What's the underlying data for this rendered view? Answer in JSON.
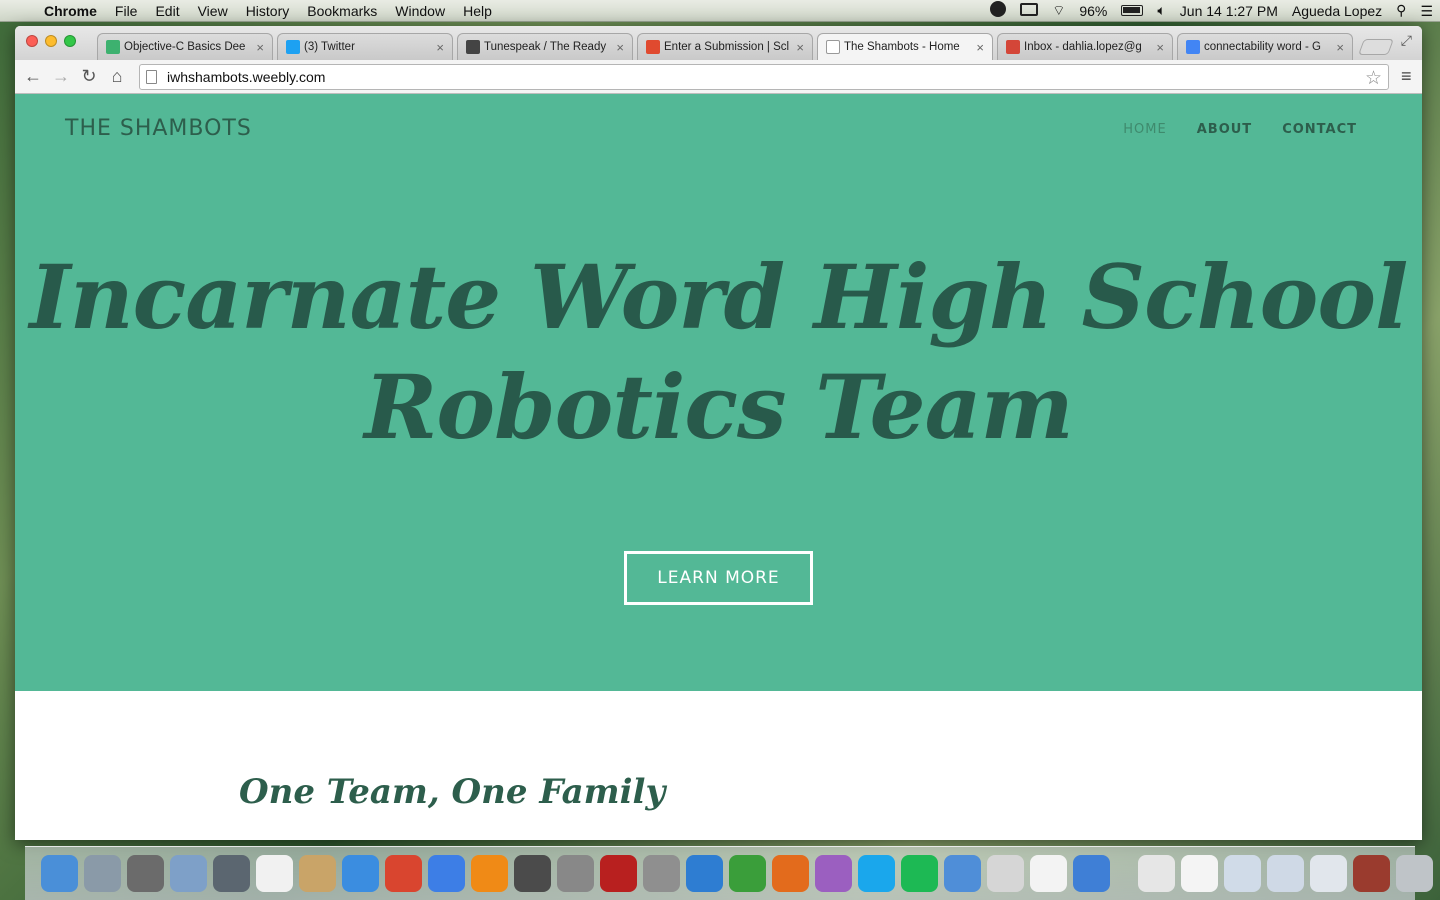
{
  "menubar": {
    "app_name": "Chrome",
    "items": [
      "File",
      "Edit",
      "View",
      "History",
      "Bookmarks",
      "Window",
      "Help"
    ],
    "battery": "96%",
    "datetime": "Jun 14  1:27 PM",
    "user": "Agueda Lopez"
  },
  "tabs": [
    {
      "title": "Objective-C Basics Dee",
      "favicon_color": "#3db16f",
      "active": false
    },
    {
      "title": "(3) Twitter",
      "favicon_color": "#1da1f2",
      "active": false
    },
    {
      "title": "Tunespeak / The Ready",
      "favicon_color": "#444444",
      "active": false
    },
    {
      "title": "Enter a Submission | Scl",
      "favicon_color": "#e04a2f",
      "active": false
    },
    {
      "title": "The Shambots - Home",
      "favicon_color": "#ffffff",
      "active": true
    },
    {
      "title": "Inbox - dahlia.lopez@g",
      "favicon_color": "#d44638",
      "active": false
    },
    {
      "title": "connectability word - G",
      "favicon_color": "#4285f4",
      "active": false
    }
  ],
  "address_bar": {
    "url": "iwhshambots.weebly.com"
  },
  "site": {
    "title": "THE SHAMBOTS",
    "nav": [
      {
        "label": "HOME",
        "active": true
      },
      {
        "label": "ABOUT",
        "active": false
      },
      {
        "label": "CONTACT",
        "active": false
      }
    ],
    "headline_line1": "Incarnate Word High School",
    "headline_line2": "Robotics Team",
    "cta_label": "LEARN MORE",
    "subheading": "One Team, One Family",
    "colors": {
      "hero_bg": "#53b896",
      "heading": "#285a4b"
    }
  },
  "dock": {
    "apps": [
      {
        "name": "finder-icon",
        "color": "#4a8fd8"
      },
      {
        "name": "launchpad-icon",
        "color": "#8a9aa8"
      },
      {
        "name": "photo-browser-icon",
        "color": "#6b6b6b"
      },
      {
        "name": "preview-icon",
        "color": "#7ea0c8"
      },
      {
        "name": "facetime-icon",
        "color": "#5b6670"
      },
      {
        "name": "calendar-icon",
        "color": "#f1f1f1"
      },
      {
        "name": "contacts-icon",
        "color": "#c9a468"
      },
      {
        "name": "safari-icon",
        "color": "#3b8de0"
      },
      {
        "name": "chrome-icon",
        "color": "#d9452f"
      },
      {
        "name": "itunes-icon",
        "color": "#3d7ee6"
      },
      {
        "name": "ibooks-icon",
        "color": "#f08a16"
      },
      {
        "name": "imovie-icon",
        "color": "#4b4b4b"
      },
      {
        "name": "no-entry-icon",
        "color": "#888888"
      },
      {
        "name": "photo-booth-icon",
        "color": "#b8201f"
      },
      {
        "name": "system-preferences-icon",
        "color": "#8f8f8f"
      },
      {
        "name": "word-icon",
        "color": "#2e7dd2"
      },
      {
        "name": "excel-icon",
        "color": "#3a9e3a"
      },
      {
        "name": "powerpoint-icon",
        "color": "#e36b1c"
      },
      {
        "name": "entourage-icon",
        "color": "#9b5fc0"
      },
      {
        "name": "skype-icon",
        "color": "#1aa7ec"
      },
      {
        "name": "spotify-icon",
        "color": "#1db954"
      },
      {
        "name": "installer-icon",
        "color": "#4f8ed8"
      },
      {
        "name": "documents-icon",
        "color": "#d6d6d6"
      },
      {
        "name": "text-edit-icon",
        "color": "#f3f3f3"
      },
      {
        "name": "xcode-icon",
        "color": "#3f7fd6"
      }
    ],
    "stacks": [
      {
        "name": "docx-file-icon",
        "color": "#e6e6e6"
      },
      {
        "name": "pdf-file-icon",
        "color": "#f4f4f4"
      },
      {
        "name": "screenshot-1-icon",
        "color": "#d0dbe8"
      },
      {
        "name": "screenshot-2-icon",
        "color": "#cfd9e6"
      },
      {
        "name": "screenshot-3-icon",
        "color": "#e1e6ec"
      },
      {
        "name": "photo-stack-icon",
        "color": "#9a3b2e"
      },
      {
        "name": "trash-icon",
        "color": "#bfc4c8"
      }
    ]
  }
}
